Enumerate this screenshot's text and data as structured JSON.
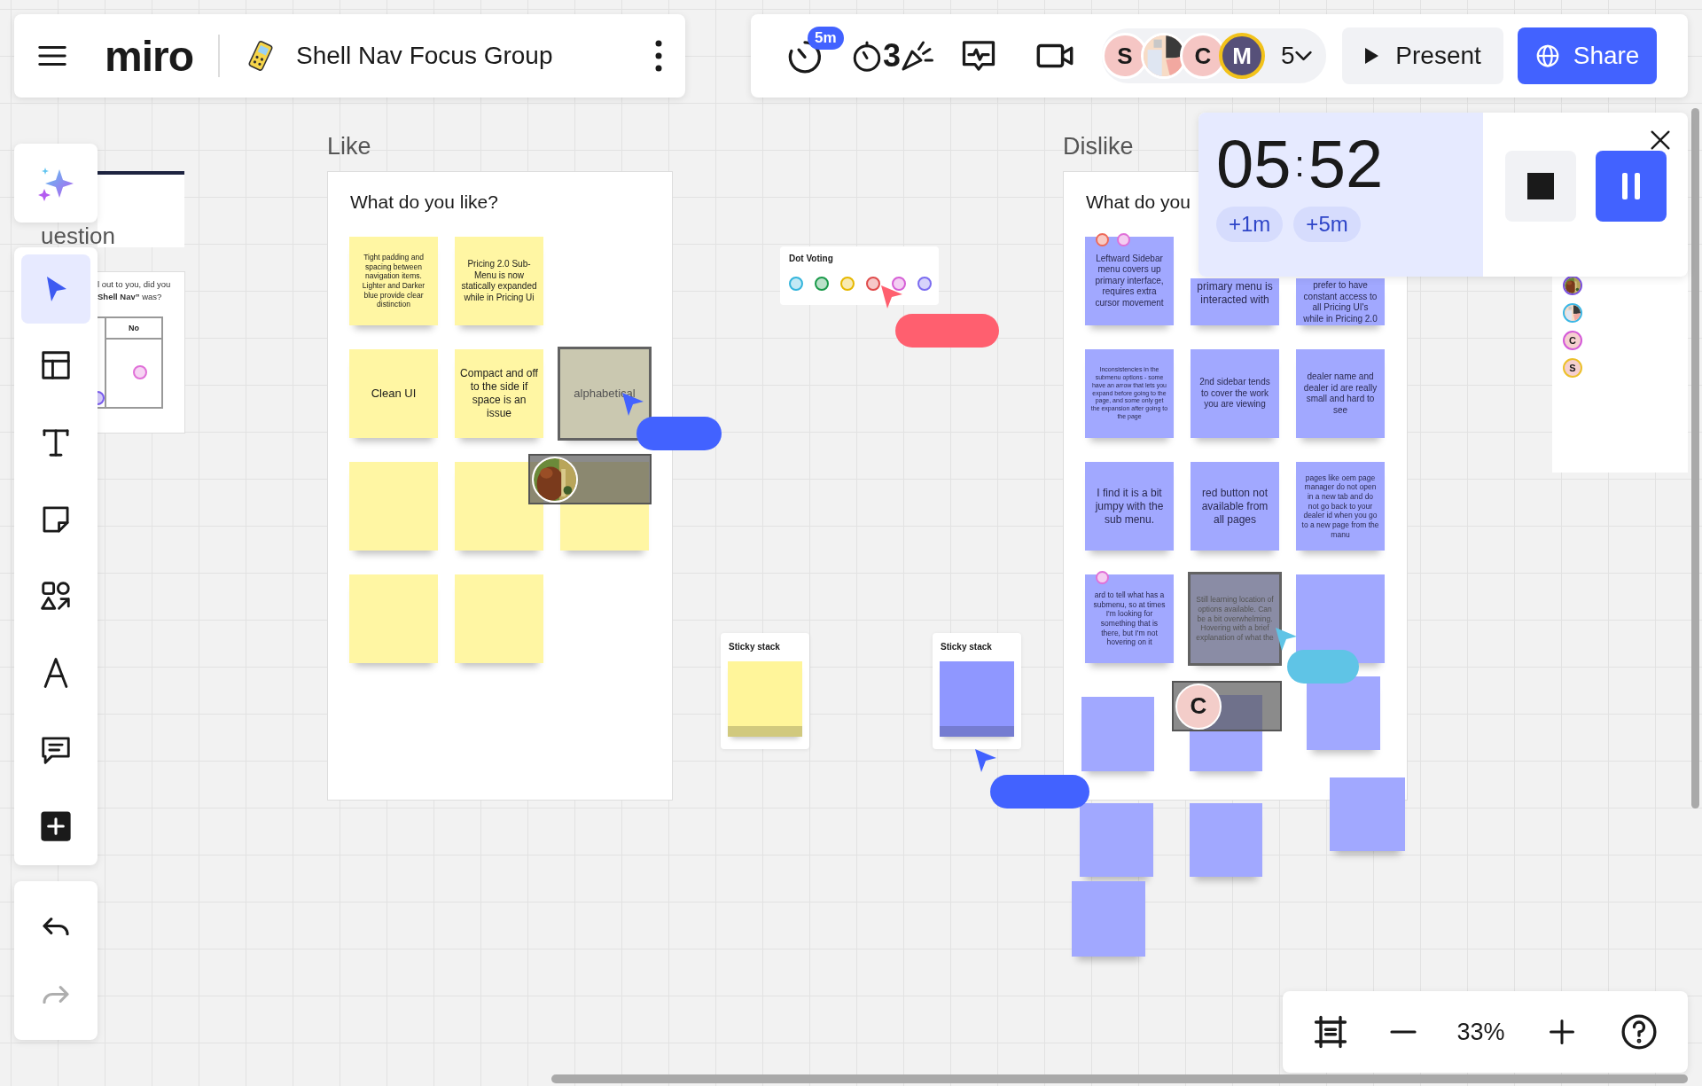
{
  "board_header": {
    "logo": "miro",
    "board_name": "Shell Nav Focus Group"
  },
  "collab_toolbar": {
    "timer_badge": "5m",
    "countdown_digit": "3",
    "collaborators": [
      {
        "kind": "letter",
        "initial": "S",
        "selected": false
      },
      {
        "kind": "picture",
        "selected": false
      },
      {
        "kind": "letter",
        "initial": "C",
        "selected": false
      },
      {
        "kind": "letter",
        "initial": "M",
        "selected": true
      }
    ],
    "collaborator_count": "5",
    "present_button": "Present",
    "share_button": "Share"
  },
  "tool_rail": {
    "tools": [
      {
        "kind": "cursor",
        "selected": true
      },
      {
        "kind": "templates",
        "selected": false
      },
      {
        "kind": "text",
        "selected": false
      },
      {
        "kind": "sticky",
        "selected": false
      },
      {
        "kind": "shapes",
        "selected": false
      },
      {
        "kind": "pen",
        "selected": false
      },
      {
        "kind": "comment",
        "selected": false
      },
      {
        "kind": "more",
        "selected": false
      }
    ]
  },
  "history": {
    "undo_disabled": false,
    "redo_disabled": true
  },
  "timer": {
    "minutes": "05",
    "separator": ":",
    "seconds": "52",
    "add_buttons": [
      "+1m",
      "+5m"
    ],
    "running": true
  },
  "online_users": [
    {
      "kind": "picture",
      "color": "#7a4fe0"
    },
    {
      "kind": "picture",
      "color": "#3bb7e5"
    },
    {
      "kind": "letter",
      "initial": "C",
      "color": "#d45ad8"
    },
    {
      "kind": "letter",
      "initial": "S",
      "color": "#ecc02a"
    }
  ],
  "zoom_bar": {
    "zoom_level": "33%"
  },
  "partial_frame": {
    "title": "uestion",
    "question_lines": [
      "l out to you, did you",
      "**Shell Nav”** was?"
    ],
    "table_header": "No",
    "votes": [
      {
        "color": "#e070d8"
      },
      {
        "color": "#7a5cf0"
      }
    ]
  },
  "like_frame": {
    "title": "Like",
    "heading": "What do you like?",
    "stickies": [
      {
        "text": "Tight padding and spacing between navigation items. Lighter and Darker blue provide clear distinction",
        "selected": false
      },
      {
        "text": "Pricing 2.0 Sub-Menu is now statically expanded while in Pricing Ui",
        "selected": false
      },
      {
        "text": "Clean UI",
        "selected": false
      },
      {
        "text": "Compact and off to the side if space is an issue",
        "selected": false
      },
      {
        "text": "alphabetical",
        "selected": true
      },
      {
        "selected": false
      },
      {
        "selected": false
      },
      {
        "selected": false
      },
      {
        "selected": false
      },
      {
        "selected": false
      }
    ]
  },
  "dislike_frame": {
    "title": "Dislike",
    "heading": "What do you",
    "stickies": [
      {
        "text": "Leftward Sidebar menu covers up primary interface, requires extra cursor movement",
        "selected": false,
        "votes": [
          {
            "color": "#ee6a5a"
          },
          {
            "color": "#e070d8"
          }
        ]
      },
      {
        "text": "primary menu is interacted with",
        "selected": false
      },
      {
        "text": "prefer to have constant access to all Pricing UI's while in Pricing 2.0",
        "selected": false
      },
      {
        "text": "Inconsistencies in the submenu options - some have an arrow that lets you expand before going to the page, and some only get the expansion after going to the page",
        "selected": false
      },
      {
        "text": "2nd sidebar tends to cover the work you are viewing",
        "selected": false
      },
      {
        "text": "dealer name and dealer id are really small and hard to see",
        "selected": false
      },
      {
        "text": "I find it is a bit jumpy with the sub menu.",
        "selected": false
      },
      {
        "text": "red button not available from all pages",
        "selected": false
      },
      {
        "text": "pages like oem page manager do not open in a new tab and do not go back to your dealer id when you go to a new page from the manu",
        "selected": false
      },
      {
        "text": "ard to tell what has a submenu, so at times I'm looking for something that is there, but I'm not hovering on it",
        "selected": false,
        "votes": [
          {
            "color": "#e070d8"
          }
        ]
      },
      {
        "text": "Still learning location of options available. Can be a bit overwhelming. Hovering with a brief explanation of what the",
        "selected": true
      },
      {
        "selected": false
      }
    ],
    "loose_stickies": [
      {
        "selected": false
      },
      {
        "selected": false
      },
      {
        "selected": false
      },
      {
        "selected": false
      },
      {
        "selected": false
      },
      {
        "selected": false
      },
      {
        "selected": false
      }
    ]
  },
  "dot_voting": {
    "title": "Dot Voting",
    "dots": [
      {
        "color": "#34b5dc"
      },
      {
        "color": "#1a9a4a"
      },
      {
        "color": "#e6b800"
      },
      {
        "color": "#e04b4b"
      },
      {
        "color": "#d65fd6"
      },
      {
        "color": "#7b6cf0"
      }
    ]
  },
  "sticky_stacks": [
    {
      "title": "Sticky stack",
      "color": "#fff59a"
    },
    {
      "title": "Sticky stack",
      "color": "#8f97ff"
    }
  ],
  "cursors": [
    {
      "color": "#4262ff"
    },
    {
      "color": "#ff5f6f"
    },
    {
      "color": "#4262ff"
    },
    {
      "color": "#5fc4e6"
    }
  ],
  "selection_ghosts": [
    {
      "avatar": {
        "kind": "picture"
      }
    },
    {
      "avatar": {
        "kind": "letter",
        "initial": "C"
      }
    }
  ]
}
